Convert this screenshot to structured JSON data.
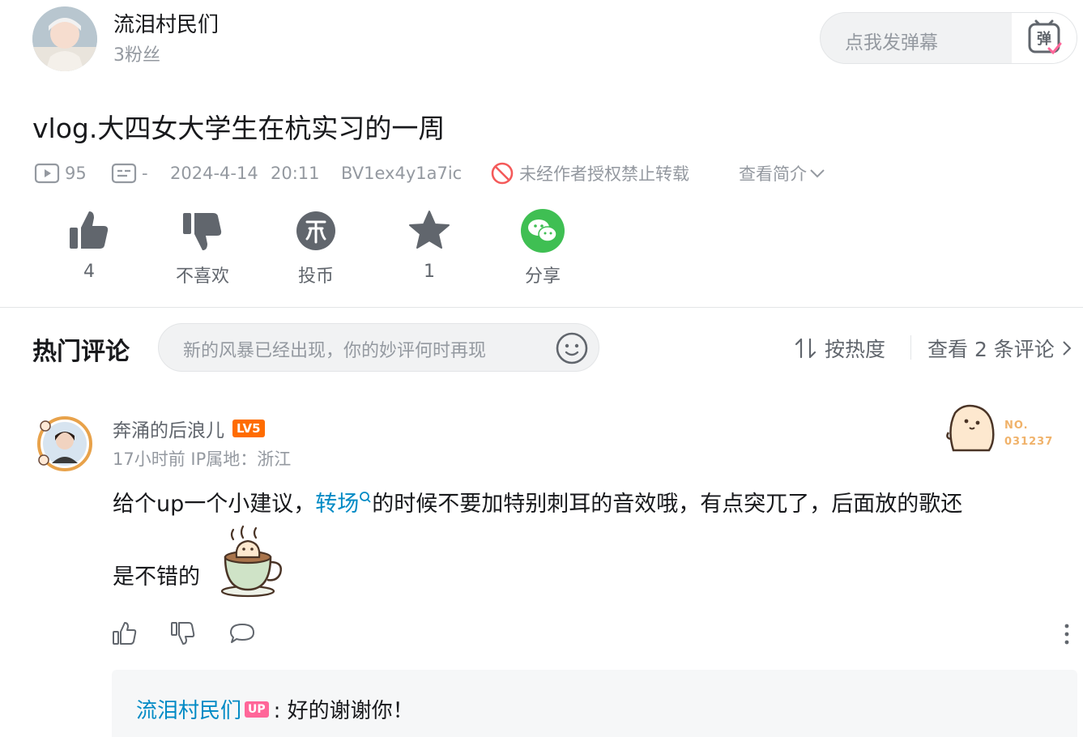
{
  "header": {
    "uploader_name": "流泪村民们",
    "fans": "3粉丝",
    "danmaku_placeholder": "点我发弹幕",
    "danmaku_button_label": "弹"
  },
  "video": {
    "title": "vlog.大四女大学生在杭实习的一周",
    "plays": "95",
    "danmaku_count": "-",
    "date": "2024-4-14",
    "time": "20:11",
    "bvid": "BV1ex4y1a7ic",
    "copyright": "未经作者授权禁止转载",
    "view_intro": "查看简介"
  },
  "actions": {
    "like": "4",
    "dislike": "不喜欢",
    "coin": "投币",
    "favorite": "1",
    "share": "分享"
  },
  "comments_section": {
    "title": "热门评论",
    "input_placeholder": "新的风暴已经出现，你的妙评何时再现",
    "sort_label": "按热度",
    "view_all": "查看 2 条评论"
  },
  "comment": {
    "user": "奔涌的后浪儿",
    "level": "LV5",
    "time_ip": "17小时前  IP属地：浙江",
    "fan_no_label": "NO.",
    "fan_no": "031237",
    "text_before": "给个up一个小建议，",
    "keyword": "转场",
    "text_after": "的时候不要加特别刺耳的音效哦，有点突兀了，后面放的歌还",
    "text_line2": "是不错的"
  },
  "reply": {
    "user": "流泪村民们",
    "tag": "UP",
    "text": ": 好的谢谢你！"
  },
  "colors": {
    "link_blue": "#008ac5",
    "level_orange": "#ff6c00",
    "up_pink": "#ff6699",
    "wechat_green": "#3fbf53"
  }
}
